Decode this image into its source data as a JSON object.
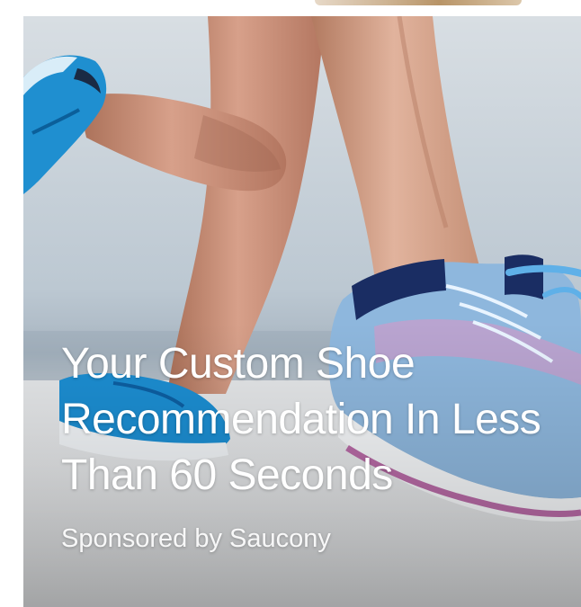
{
  "ad": {
    "headline_lines": [
      "Your Custom Shoe",
      "Recommendation In Less",
      "Than 60 Seconds"
    ],
    "sponsor_text": "Sponsored by Saucony"
  },
  "image": {
    "subject": "runner-legs-with-running-shoes",
    "colors": {
      "sky": "#c9d3db",
      "ground": "#e8e9ea",
      "skin": "#c58f74",
      "shoe_back": "#1f8fd0",
      "shoe_front": "#8eb7dd",
      "shoe_accent": "#c57fb3"
    }
  }
}
